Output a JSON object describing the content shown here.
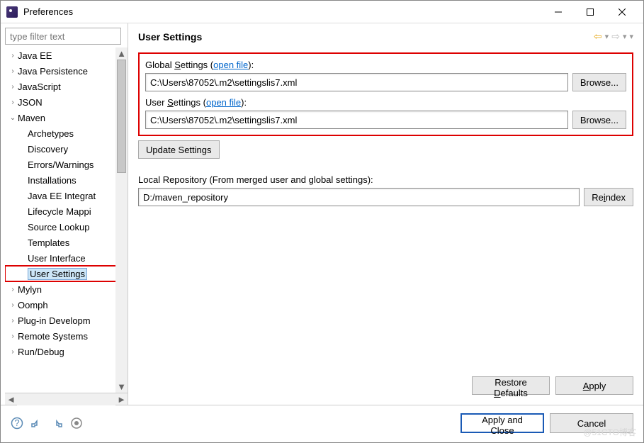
{
  "window": {
    "title": "Preferences"
  },
  "left": {
    "filter_placeholder": "type filter text",
    "tree": [
      {
        "label": "Java EE",
        "expanded": false
      },
      {
        "label": "Java Persistence",
        "expanded": false
      },
      {
        "label": "JavaScript",
        "expanded": false
      },
      {
        "label": "JSON",
        "expanded": false
      },
      {
        "label": "Maven",
        "expanded": true,
        "children": [
          {
            "label": "Archetypes"
          },
          {
            "label": "Discovery"
          },
          {
            "label": "Errors/Warnings"
          },
          {
            "label": "Installations"
          },
          {
            "label": "Java EE Integrat"
          },
          {
            "label": "Lifecycle Mappi"
          },
          {
            "label": "Source Lookup"
          },
          {
            "label": "Templates"
          },
          {
            "label": "User Interface"
          },
          {
            "label": "User Settings",
            "selected": true
          }
        ]
      },
      {
        "label": "Mylyn",
        "expanded": false
      },
      {
        "label": "Oomph",
        "expanded": false
      },
      {
        "label": "Plug-in Developm",
        "expanded": false
      },
      {
        "label": "Remote Systems",
        "expanded": false
      },
      {
        "label": "Run/Debug",
        "expanded": false
      }
    ]
  },
  "right": {
    "title": "User Settings",
    "global_label_pre": "Global ",
    "global_label_u": "S",
    "global_label_post": "ettings (",
    "openfile": "open file",
    "label_close": "):",
    "global_value": "C:\\Users\\87052\\.m2\\settingslis7.xml",
    "user_label_pre": "User ",
    "user_label_u": "S",
    "user_label_post": "ettings (",
    "user_value": "C:\\Users\\87052\\.m2\\settingslis7.xml",
    "browse": "Browse...",
    "update": "Update Settings",
    "local_label": "Local Repository (From merged user and global settings):",
    "local_value": "D:/maven_repository",
    "reindex_pre": "Re",
    "reindex_u": "i",
    "reindex_post": "ndex",
    "restore_pre": "Restore ",
    "restore_u": "D",
    "restore_post": "efaults",
    "apply_u": "A",
    "apply_post": "pply"
  },
  "footer": {
    "apply_close": "Apply and Close",
    "cancel": "Cancel"
  }
}
